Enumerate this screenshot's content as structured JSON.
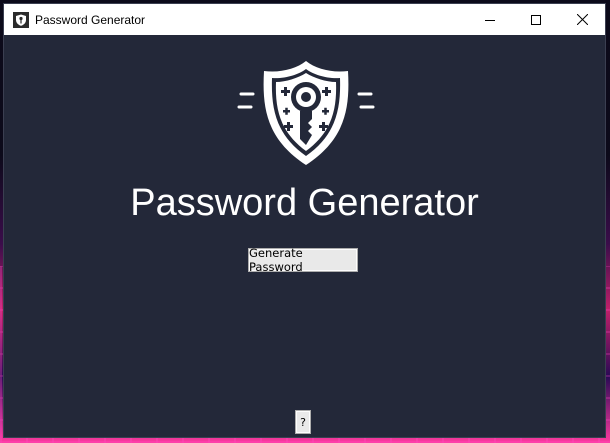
{
  "window": {
    "title": "Password Generator",
    "app_icon": "key-shield-app-icon",
    "controls": [
      "minimize-icon",
      "maximize-icon",
      "close-icon"
    ]
  },
  "main": {
    "logo_icon": "shield-key-icon",
    "heading": "Password Generator",
    "generate_button_label": "Generate Password",
    "help_button_label": "?"
  },
  "colors": {
    "window_background": "#232839",
    "heading_text": "#ffffff",
    "titlebar": "#ffffff"
  }
}
